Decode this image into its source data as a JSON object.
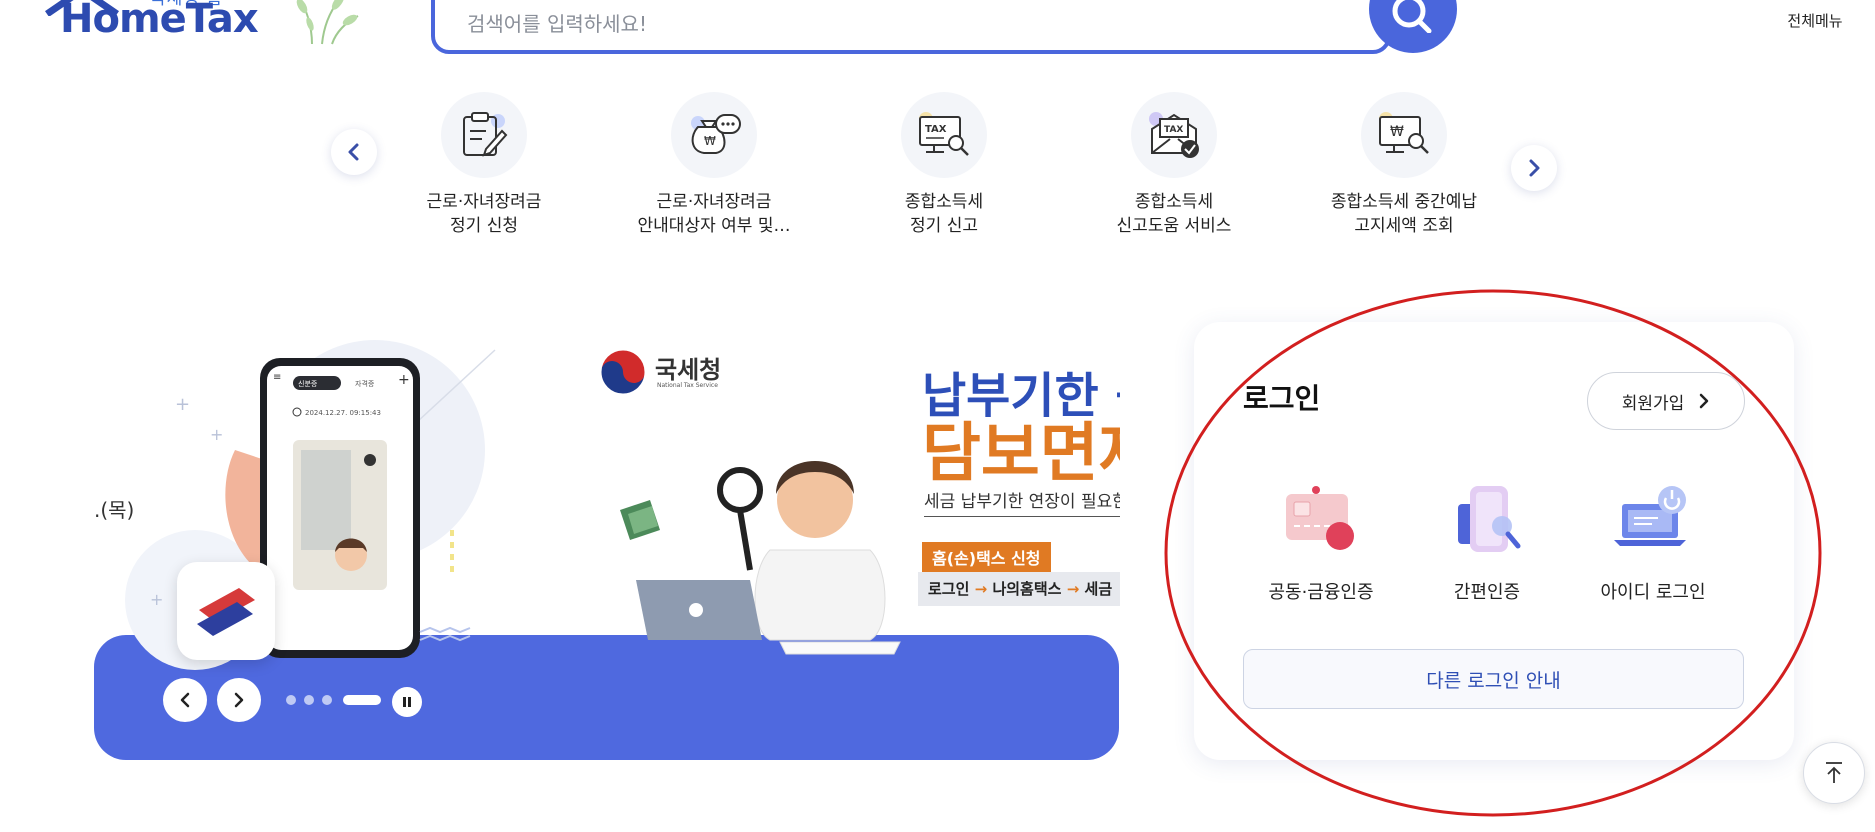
{
  "header": {
    "logo_sub": "국세청 홈",
    "logo_text": "HomeTax",
    "search_placeholder": "검색어를 입력하세요!",
    "menu_label": "전체메뉴"
  },
  "quick_menu": {
    "items": [
      {
        "line1": "근로·자녀장려금",
        "line2": "정기 신청",
        "icon": "clipboard-pen-icon"
      },
      {
        "line1": "근로·자녀장려금",
        "line2": "안내대상자 여부 및…",
        "icon": "money-bag-chat-icon"
      },
      {
        "line1": "종합소득세",
        "line2": "정기 신고",
        "icon": "tax-monitor-search-icon"
      },
      {
        "line1": "종합소득세",
        "line2": "신고도움 서비스",
        "icon": "tax-envelope-check-icon"
      },
      {
        "line1": "종합소득세 중간예납",
        "line2": "고지세액 조회",
        "icon": "won-monitor-search-icon"
      }
    ]
  },
  "banner": {
    "date_fragment": ".(목)",
    "phone_tab_active": "신분증",
    "phone_tab_other": "자격증",
    "phone_time": "2024.12.27. 09:15:43",
    "nts_name": "국세청",
    "nts_eng": "National Tax Service",
    "headline1": "납부기한 등",
    "headline2": "담보면제",
    "subline": "세금 납부기한 연장이 필요한",
    "tag": "홈(손)택스 신청",
    "path": [
      "로그인",
      "나의홈택스",
      "세금"
    ],
    "path_arrow": "→"
  },
  "login": {
    "title": "로그인",
    "signup": "회원가입",
    "options": [
      {
        "label": "공동·금융인증",
        "icon": "certificate-card-icon"
      },
      {
        "label": "간편인증",
        "icon": "phone-search-icon"
      },
      {
        "label": "아이디 로그인",
        "icon": "laptop-power-icon"
      }
    ],
    "other": "다른 로그인 안내"
  },
  "colors": {
    "primary": "#4a66dc",
    "banner_blue": "#4f69df",
    "accent_orange": "#e07a23",
    "annotation_red": "#d21f1f"
  }
}
